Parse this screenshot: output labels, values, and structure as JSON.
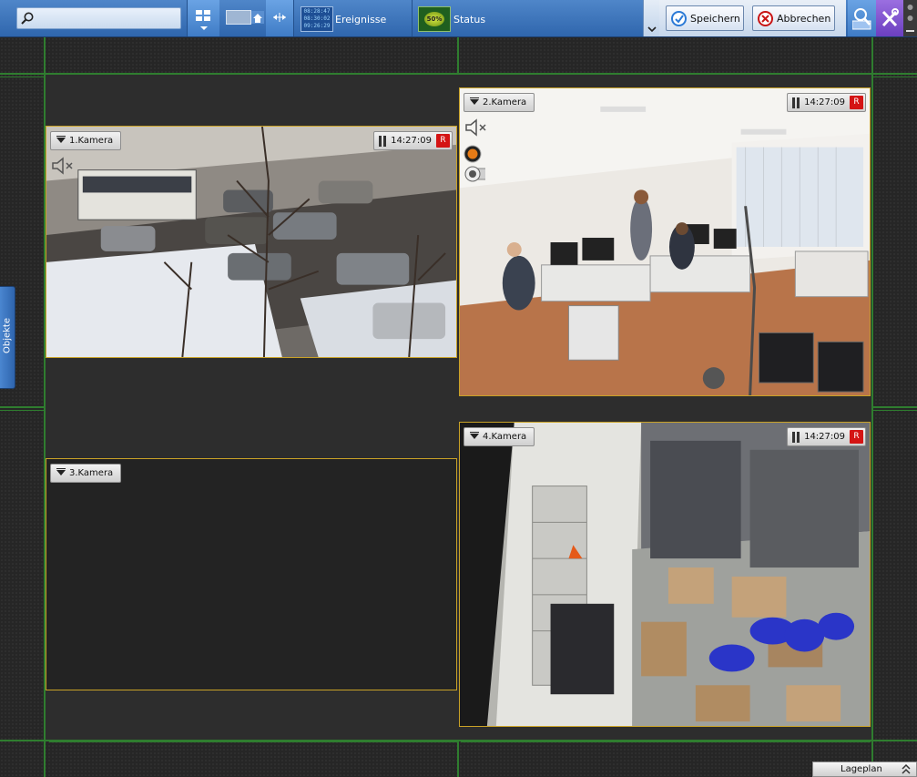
{
  "toolbar": {
    "search_placeholder": "",
    "events_label": "Ereignisse",
    "events_icon_lines": [
      "08:28:47",
      "08:30:02",
      "09:26:29"
    ],
    "status_label": "Status",
    "status_icon_text": "50%",
    "save_label": "Speichern",
    "cancel_label": "Abbrechen"
  },
  "cameras": [
    {
      "label": "1.Kamera",
      "time": "14:27:09",
      "rec": "R",
      "scene": "street-snow"
    },
    {
      "label": "2.Kamera",
      "time": "14:27:09",
      "rec": "R",
      "scene": "office"
    },
    {
      "label": "3.Kamera",
      "scene": "empty"
    },
    {
      "label": "4.Kamera",
      "time": "14:27:09",
      "rec": "R",
      "scene": "warehouse"
    }
  ],
  "side_tab": {
    "label": "Objekte"
  },
  "bottom_panel": {
    "label": "Lageplan"
  },
  "colors": {
    "toolbar": "#3b75bd",
    "grid_line": "#2f7d2f",
    "tile_border": "#c9a227",
    "record": "#d41414",
    "accent_purple": "#7a4fd0"
  },
  "icons": [
    "search-icon",
    "layout-grid-icon",
    "events-icon",
    "status-gauge-icon",
    "check-icon",
    "cancel-x-icon",
    "object-search-icon",
    "settings-tools-icon",
    "pause-icon",
    "mute-icon",
    "record-icon",
    "chevron-up-icon"
  ]
}
